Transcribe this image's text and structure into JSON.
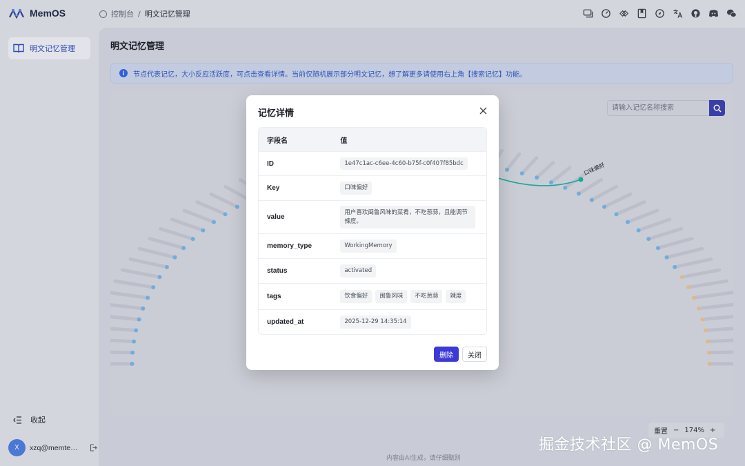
{
  "app": {
    "name": "MemOS"
  },
  "breadcrumb": {
    "root": "控制台",
    "separator": "/",
    "current": "明文记忆管理"
  },
  "top_icons": [
    "chat-icon",
    "gauge-icon",
    "link-icon",
    "bookmark-icon",
    "compass-icon",
    "translate-icon",
    "github-icon",
    "discord-icon",
    "wechat-icon"
  ],
  "sidebar": {
    "items": [
      {
        "label": "明文记忆管理",
        "icon": "book-icon",
        "active": true
      }
    ],
    "collapse_label": "收起",
    "user": {
      "initial": "X",
      "email": "xzq@memtensor.cn"
    }
  },
  "main": {
    "title": "明文记忆管理",
    "banner": "节点代表记忆，大小反应活跃度，可点击查看详情。当前仅随机展示部分明文记忆，想了解更多请使用右上角【搜索记忆】功能。",
    "search_placeholder": "请输入记忆名称搜索",
    "zoom": {
      "reset_label": "重置",
      "minus": "−",
      "level": "174%",
      "plus": "+"
    },
    "footer_note": "内容由AI生成，请仔细甄别"
  },
  "modal": {
    "title": "记忆详情",
    "headers": {
      "field": "字段名",
      "value": "值"
    },
    "rows": [
      {
        "field": "ID",
        "value": "1e47c1ac-c6ee-4c60-b75f-c0f407f85bdc"
      },
      {
        "field": "Key",
        "value": "口味偏好"
      },
      {
        "field": "value",
        "value": "用户喜欢闽鲁风味的菜肴，不吃葱蒜，且能调节辣度。"
      },
      {
        "field": "memory_type",
        "value": "WorkingMemory"
      },
      {
        "field": "status",
        "value": "activated"
      },
      {
        "field": "tags",
        "tags": [
          "饮食偏好",
          "闽鲁风味",
          "不吃葱蒜",
          "辣度"
        ]
      },
      {
        "field": "updated_at",
        "value": "2025-12-29 14:35:14"
      }
    ],
    "delete_label": "删除",
    "close_label": "关闭"
  },
  "graph": {
    "highlight_label": "口味偏好"
  },
  "watermark": "掘金技术社区 @ MemOS",
  "colors": {
    "accent": "#3c39d6",
    "graph_node": "#58a6e0",
    "graph_edge": "#1aa79c",
    "info": "#2f62d8"
  }
}
